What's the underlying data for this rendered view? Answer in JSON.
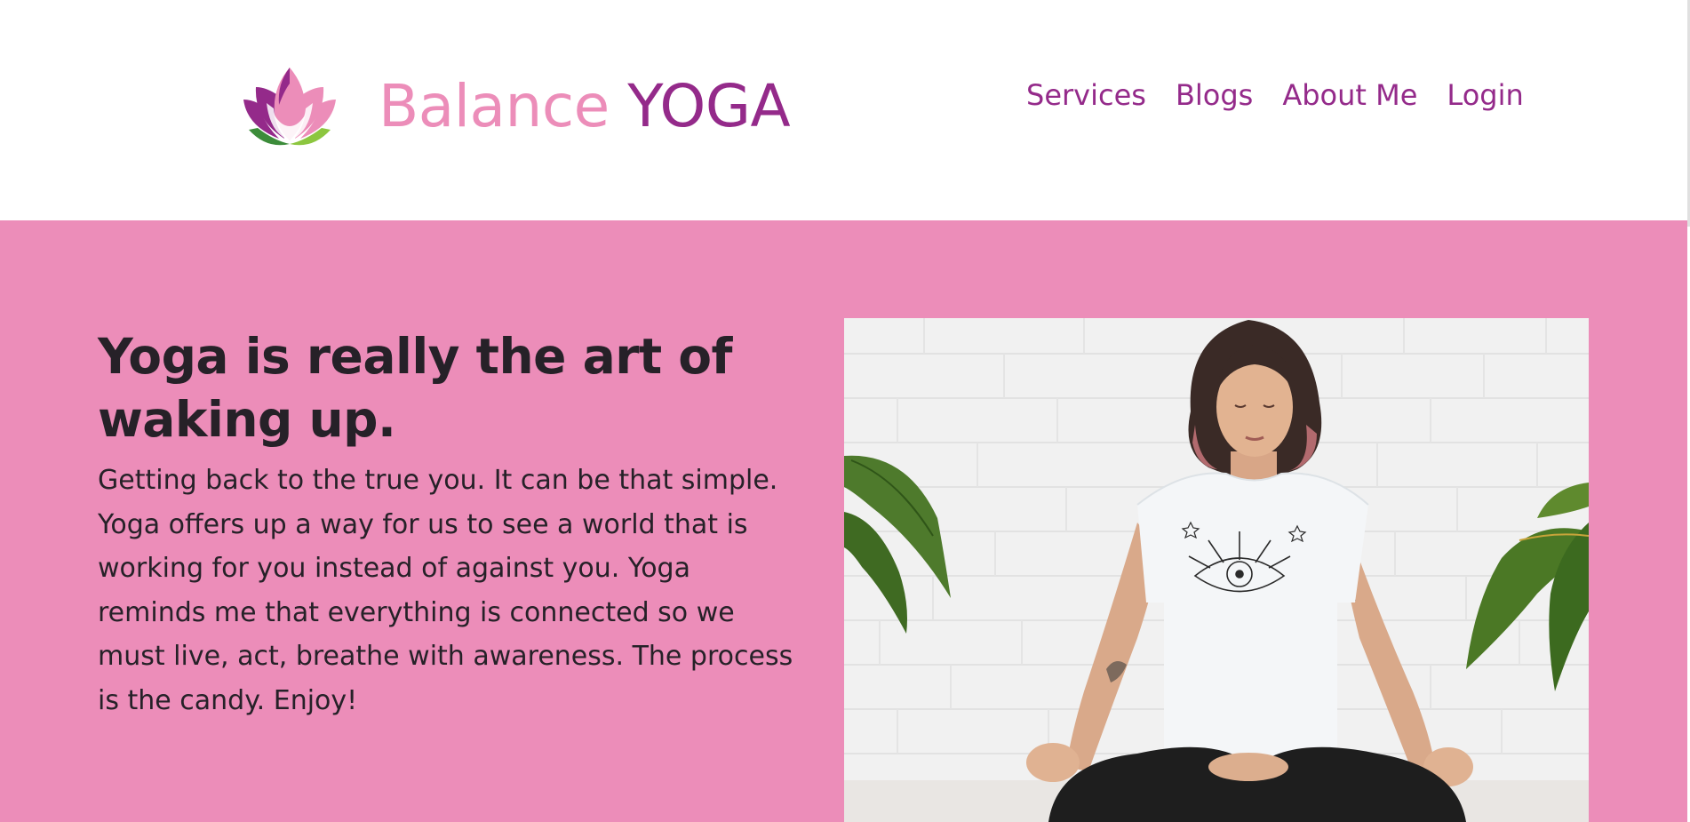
{
  "header": {
    "brand": {
      "part1": "Balance",
      "part2": "YOGA",
      "logo_icon": "lotus-icon"
    },
    "nav": [
      {
        "label": "Services"
      },
      {
        "label": "Blogs"
      },
      {
        "label": "About Me"
      },
      {
        "label": "Login"
      }
    ]
  },
  "hero": {
    "heading": "Yoga is really the art of waking up.",
    "text": "Getting back to the true you. It can be that simple. Yoga offers up a way for us to see a world that is working for you instead of against you. Yoga reminds me that everything is connected so we must live, act, breathe with awareness. The process is the candy. Enjoy!",
    "image": "woman-meditating-photo"
  },
  "colors": {
    "brand_pink": "#ec8db9",
    "brand_purple": "#942a8a",
    "text_dark": "#262128",
    "hero_bg": "#ec8db9",
    "header_bg": "#ffffff",
    "leaf_green": "#74c043"
  }
}
